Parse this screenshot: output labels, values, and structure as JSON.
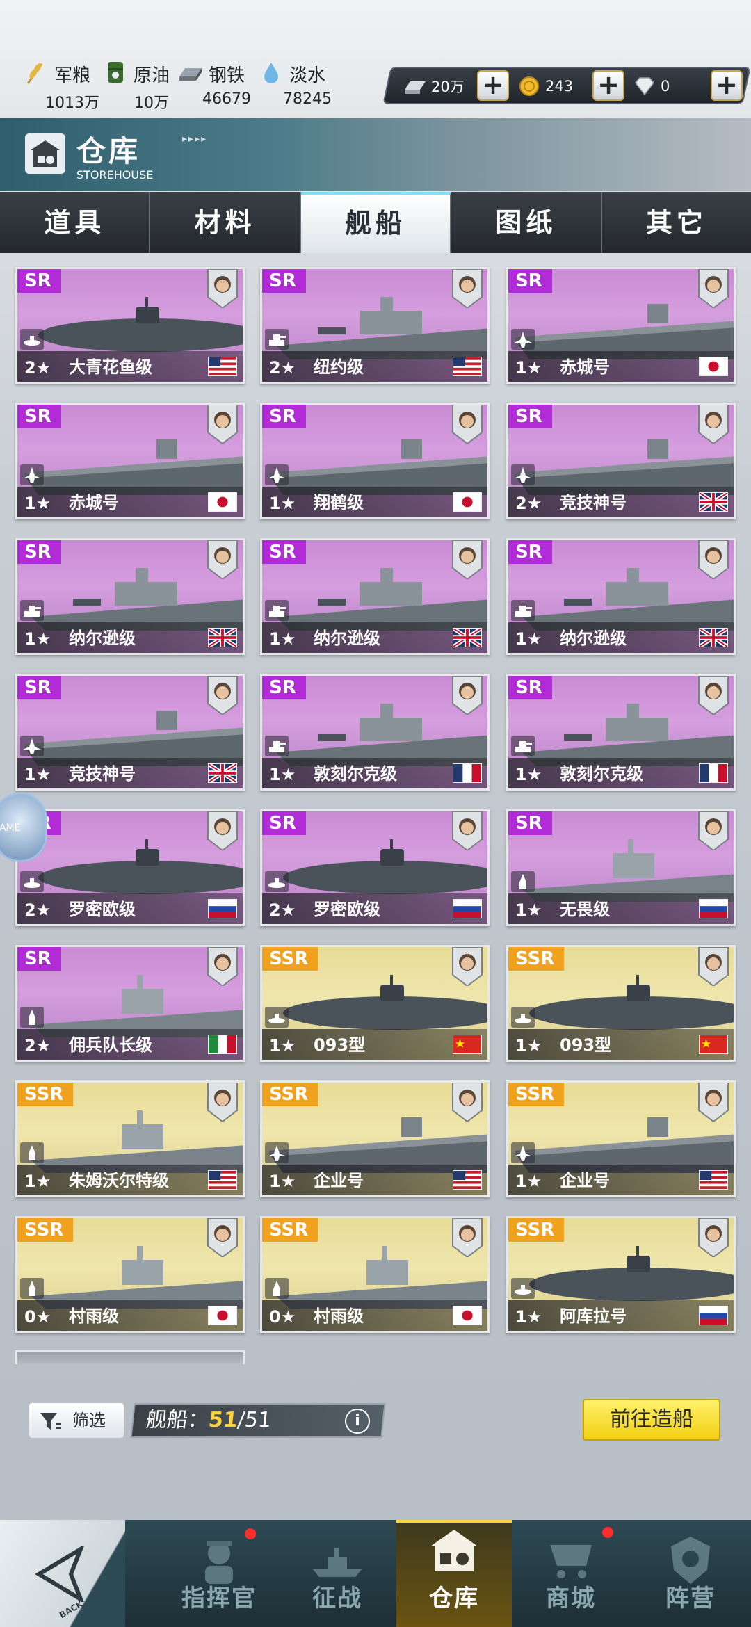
{
  "resources": [
    {
      "name": "军粮",
      "value": "1013万",
      "icon": "wheat-icon"
    },
    {
      "name": "原油",
      "value": "10万",
      "icon": "oil-barrel-icon"
    },
    {
      "name": "钢铁",
      "value": "46679",
      "icon": "steel-ingot-icon"
    },
    {
      "name": "淡水",
      "value": "78245",
      "icon": "water-drop-icon"
    }
  ],
  "currencies": [
    {
      "value": "20万",
      "icon": "silver-bar-icon"
    },
    {
      "value": "243",
      "icon": "gold-coin-icon"
    },
    {
      "value": "0",
      "icon": "diamond-icon"
    }
  ],
  "header": {
    "title": "仓库",
    "subtitle": "STOREHOUSE"
  },
  "tabs": [
    "道具",
    "材料",
    "舰船",
    "图纸",
    "其它"
  ],
  "active_tab": "舰船",
  "ships": [
    {
      "rarity": "SR",
      "stars": "2★",
      "name": "大青花鱼级",
      "type": "submarine",
      "flag": "usa"
    },
    {
      "rarity": "SR",
      "stars": "2★",
      "name": "纽约级",
      "type": "battleship",
      "flag": "usa"
    },
    {
      "rarity": "SR",
      "stars": "1★",
      "name": "赤城号",
      "type": "carrier",
      "flag": "japan"
    },
    {
      "rarity": "SR",
      "stars": "1★",
      "name": "赤城号",
      "type": "carrier",
      "flag": "japan"
    },
    {
      "rarity": "SR",
      "stars": "1★",
      "name": "翔鹤级",
      "type": "carrier",
      "flag": "japan"
    },
    {
      "rarity": "SR",
      "stars": "2★",
      "name": "竞技神号",
      "type": "carrier",
      "flag": "uk"
    },
    {
      "rarity": "SR",
      "stars": "1★",
      "name": "纳尔逊级",
      "type": "battleship",
      "flag": "uk"
    },
    {
      "rarity": "SR",
      "stars": "1★",
      "name": "纳尔逊级",
      "type": "battleship",
      "flag": "uk"
    },
    {
      "rarity": "SR",
      "stars": "1★",
      "name": "纳尔逊级",
      "type": "battleship",
      "flag": "uk"
    },
    {
      "rarity": "SR",
      "stars": "1★",
      "name": "竞技神号",
      "type": "carrier",
      "flag": "uk"
    },
    {
      "rarity": "SR",
      "stars": "1★",
      "name": "敦刻尔克级",
      "type": "battleship",
      "flag": "france"
    },
    {
      "rarity": "SR",
      "stars": "1★",
      "name": "敦刻尔克级",
      "type": "battleship",
      "flag": "france"
    },
    {
      "rarity": "SR",
      "stars": "2★",
      "name": "罗密欧级",
      "type": "submarine",
      "flag": "russia"
    },
    {
      "rarity": "SR",
      "stars": "2★",
      "name": "罗密欧级",
      "type": "submarine",
      "flag": "russia"
    },
    {
      "rarity": "SR",
      "stars": "1★",
      "name": "无畏级",
      "type": "destroyer",
      "flag": "russia"
    },
    {
      "rarity": "SR",
      "stars": "2★",
      "name": "佣兵队长级",
      "type": "destroyer",
      "flag": "italy"
    },
    {
      "rarity": "SSR",
      "stars": "1★",
      "name": "093型",
      "type": "submarine",
      "flag": "china"
    },
    {
      "rarity": "SSR",
      "stars": "1★",
      "name": "093型",
      "type": "submarine",
      "flag": "china"
    },
    {
      "rarity": "SSR",
      "stars": "1★",
      "name": "朱姆沃尔特级",
      "type": "destroyer",
      "flag": "usa"
    },
    {
      "rarity": "SSR",
      "stars": "1★",
      "name": "企业号",
      "type": "carrier",
      "flag": "usa"
    },
    {
      "rarity": "SSR",
      "stars": "1★",
      "name": "企业号",
      "type": "carrier",
      "flag": "usa"
    },
    {
      "rarity": "SSR",
      "stars": "0★",
      "name": "村雨级",
      "type": "destroyer",
      "flag": "japan"
    },
    {
      "rarity": "SSR",
      "stars": "0★",
      "name": "村雨级",
      "type": "destroyer",
      "flag": "japan"
    },
    {
      "rarity": "SSR",
      "stars": "1★",
      "name": "阿库拉号",
      "type": "submarine",
      "flag": "russia"
    }
  ],
  "filter": {
    "label": "筛选"
  },
  "count": {
    "label": "舰船：",
    "current": "51",
    "separator": "/",
    "total": "51"
  },
  "build_button": "前往造船",
  "nav": [
    {
      "label": "指挥官",
      "icon": "commander-icon",
      "badge": true
    },
    {
      "label": "征战",
      "icon": "battleship-icon",
      "badge": false
    },
    {
      "label": "仓库",
      "icon": "storehouse-icon",
      "badge": false,
      "active": true
    },
    {
      "label": "商城",
      "icon": "shop-cart-icon",
      "badge": true
    },
    {
      "label": "阵营",
      "icon": "faction-emblem-icon",
      "badge": false
    }
  ],
  "back_button": {
    "label": "BACK"
  },
  "side_float": {
    "label": "AME"
  }
}
